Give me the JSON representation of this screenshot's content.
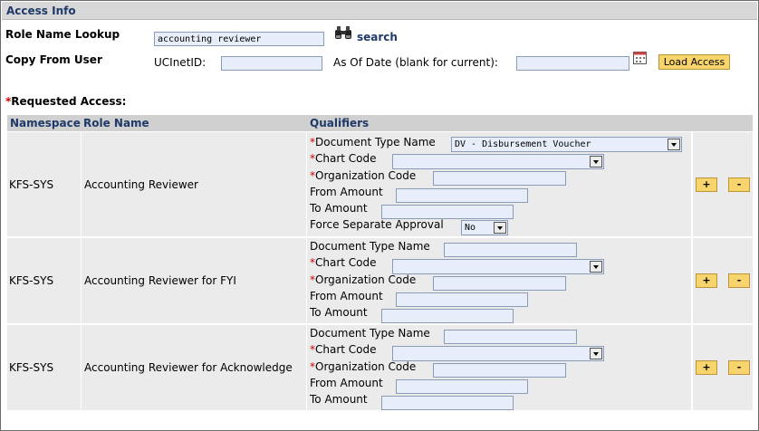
{
  "section_title": "Access Info",
  "role_lookup": {
    "label": "Role Name Lookup",
    "value": "accounting reviewer",
    "search_label": "search"
  },
  "copy_from": {
    "label": "Copy From User",
    "ucinetid_label": "UCInetID:",
    "ucinetid_value": "",
    "asof_label": "As Of Date (blank for current):",
    "asof_value": "",
    "load_button": "Load Access"
  },
  "requested": {
    "asterisk": "*",
    "label": "Requested Access:"
  },
  "table": {
    "headers": {
      "namespace": "Namespace",
      "role_name": "Role Name",
      "qualifiers": "Qualifiers"
    },
    "rows": [
      {
        "namespace": "KFS-SYS",
        "role": "Accounting Reviewer",
        "q_doc_type_label": "Document Type Name",
        "q_doc_type_value": "DV - Disbursement Voucher",
        "q_chart_label": "Chart Code",
        "q_org_label": "Organization Code",
        "q_from_label": "From Amount",
        "q_to_label": "To Amount",
        "q_force_label": "Force Separate Approval",
        "q_force_value": "No"
      },
      {
        "namespace": "KFS-SYS",
        "role": "Accounting Reviewer for FYI",
        "q_doc_type_label": "Document Type Name",
        "q_chart_label": "Chart Code",
        "q_org_label": "Organization Code",
        "q_from_label": "From Amount",
        "q_to_label": "To Amount"
      },
      {
        "namespace": "KFS-SYS",
        "role": "Accounting Reviewer for Acknowledge",
        "q_doc_type_label": "Document Type Name",
        "q_chart_label": "Chart Code",
        "q_org_label": "Organization Code",
        "q_from_label": "From Amount",
        "q_to_label": "To Amount"
      }
    ],
    "add_label": "+",
    "remove_label": "-",
    "required_mark": "*"
  }
}
